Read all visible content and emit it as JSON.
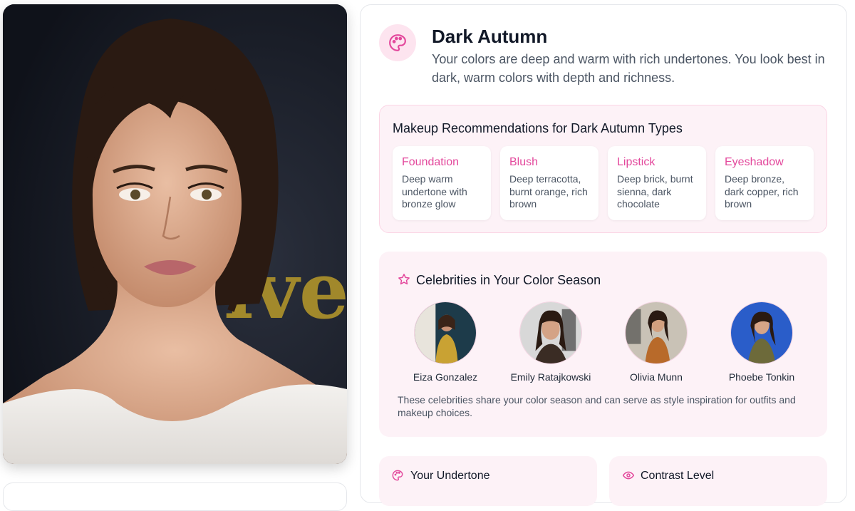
{
  "season": {
    "icon": "palette-icon",
    "title": "Dark Autumn",
    "description": "Your colors are deep and warm with rich undertones. You look best in dark, warm colors with depth and richness."
  },
  "makeup": {
    "title": "Makeup Recommendations for Dark Autumn Types",
    "items": [
      {
        "name": "Foundation",
        "desc": "Deep warm undertone with bronze glow"
      },
      {
        "name": "Blush",
        "desc": "Deep terracotta, burnt orange, rich brown"
      },
      {
        "name": "Lipstick",
        "desc": "Deep brick, burnt sienna, dark chocolate"
      },
      {
        "name": "Eyeshadow",
        "desc": "Deep bronze, dark copper, rich brown"
      }
    ]
  },
  "celebrities": {
    "icon": "star-icon",
    "title": "Celebrities in Your Color Season",
    "people": [
      {
        "name": "Eiza Gonzalez"
      },
      {
        "name": "Emily Ratajkowski"
      },
      {
        "name": "Olivia Munn"
      },
      {
        "name": "Phoebe Tonkin"
      }
    ],
    "note": "These celebrities share your color season and can serve as style inspiration for outfits and makeup choices."
  },
  "undertone": {
    "icon": "palette-icon",
    "title": "Your Undertone"
  },
  "contrast": {
    "icon": "eye-icon",
    "title": "Contrast Level"
  },
  "colors": {
    "accent": "#e3489c",
    "panel_bg": "#fdf2f7"
  }
}
